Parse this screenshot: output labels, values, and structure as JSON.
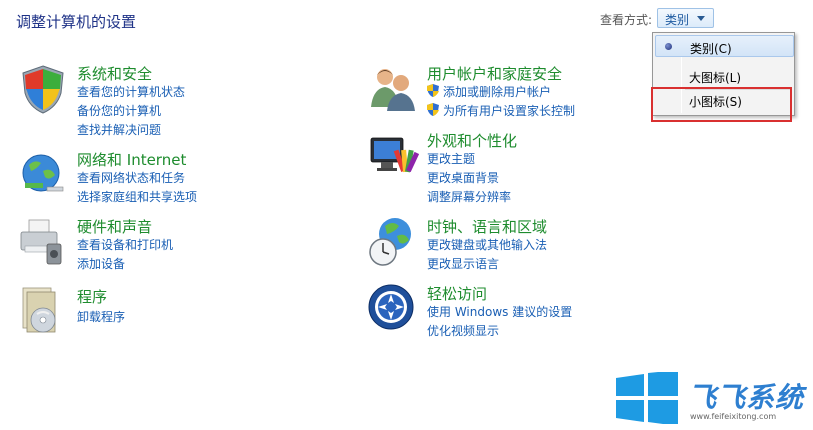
{
  "header": {
    "title": "调整计算机的设置",
    "view_by_label": "查看方式:",
    "view_by_value": "类别"
  },
  "menu": {
    "items": [
      {
        "label": "类别(C)",
        "checked": true
      },
      {
        "label": "大图标(L)",
        "checked": false
      },
      {
        "label": "小图标(S)",
        "checked": false
      }
    ]
  },
  "categories": {
    "system": {
      "title": "系统和安全",
      "icon": "shield-icon",
      "links": [
        "查看您的计算机状态",
        "备份您的计算机",
        "查找并解决问题"
      ]
    },
    "network": {
      "title": "网络和 Internet",
      "icon": "network-globe-icon",
      "links": [
        "查看网络状态和任务",
        "选择家庭组和共享选项"
      ]
    },
    "hardware": {
      "title": "硬件和声音",
      "icon": "printer-icon",
      "links": [
        "查看设备和打印机",
        "添加设备"
      ]
    },
    "programs": {
      "title": "程序",
      "icon": "programs-disc-icon",
      "links": [
        "卸载程序"
      ]
    },
    "users": {
      "title": "用户帐户和家庭安全",
      "icon": "users-icon",
      "links": [
        "添加或删除用户帐户",
        "为所有用户设置家长控制"
      ]
    },
    "appearance": {
      "title": "外观和个性化",
      "icon": "monitor-color-icon",
      "links": [
        "更改主题",
        "更改桌面背景",
        "调整屏幕分辨率"
      ]
    },
    "clock": {
      "title": "时钟、语言和区域",
      "icon": "clock-globe-icon",
      "links": [
        "更改键盘或其他输入法",
        "更改显示语言"
      ]
    },
    "access": {
      "title": "轻松访问",
      "icon": "ease-of-access-icon",
      "links": [
        "使用 Windows 建议的设置",
        "优化视频显示"
      ]
    }
  },
  "watermark": {
    "brand": "飞飞系统",
    "url": "www.feifeixitong.com"
  },
  "colors": {
    "title_green": "#1e8c2e",
    "link_blue": "#1a5fb4",
    "highlight_red": "#d93030",
    "logo_blue": "#2e7fd0"
  }
}
